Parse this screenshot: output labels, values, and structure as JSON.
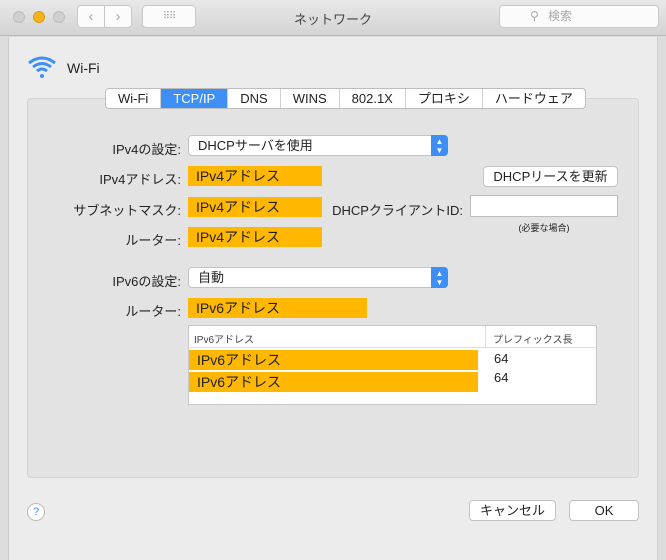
{
  "window": {
    "title": "ネットワーク",
    "search_placeholder": "検索"
  },
  "service": {
    "name": "Wi-Fi"
  },
  "tabs": [
    "Wi-Fi",
    "TCP/IP",
    "DNS",
    "WINS",
    "802.1X",
    "プロキシ",
    "ハードウェア"
  ],
  "selected_tab": "TCP/IP",
  "ipv4": {
    "config_label": "IPv4の設定:",
    "config_value": "DHCPサーバを使用",
    "address_label": "IPv4アドレス:",
    "address_value": "IPv4アドレス",
    "subnet_label": "サブネットマスク:",
    "subnet_value": "IPv4アドレス",
    "router_label": "ルーター:",
    "router_value": "IPv4アドレス",
    "renew_button": "DHCPリースを更新",
    "client_id_label": "DHCPクライアントID:",
    "client_id_value": "",
    "client_id_hint": "(必要な場合)"
  },
  "ipv6": {
    "config_label": "IPv6の設定:",
    "config_value": "自動",
    "router_label": "ルーター:",
    "router_value": "IPv6アドレス",
    "table": {
      "headers": [
        "IPv6アドレス",
        "プレフィックス長"
      ],
      "rows": [
        [
          "IPv6アドレス",
          "64"
        ],
        [
          "IPv6アドレス",
          "64"
        ]
      ]
    }
  },
  "footer": {
    "help": "?",
    "cancel": "キャンセル",
    "ok": "OK"
  },
  "colors": {
    "accent": "#3d8ef5",
    "highlight": "#ffb700"
  }
}
